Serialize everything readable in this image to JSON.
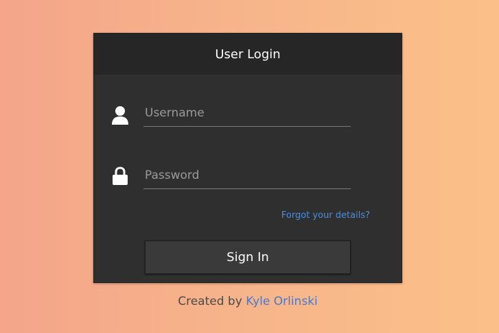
{
  "login": {
    "title": "User Login",
    "username": {
      "value": "",
      "placeholder": "Username",
      "icon": "user-icon"
    },
    "password": {
      "value": "",
      "placeholder": "Password",
      "icon": "lock-icon"
    },
    "forgot_label": "Forgot your details?",
    "signin_label": "Sign In"
  },
  "footer": {
    "prefix": "Created by",
    "author": "Kyle Orlinski"
  },
  "colors": {
    "card_bg": "#2f2f2f",
    "header_bg": "#262626",
    "link": "#4a8fe0",
    "background_start": "#f4a58a",
    "background_end": "#fbc089"
  }
}
